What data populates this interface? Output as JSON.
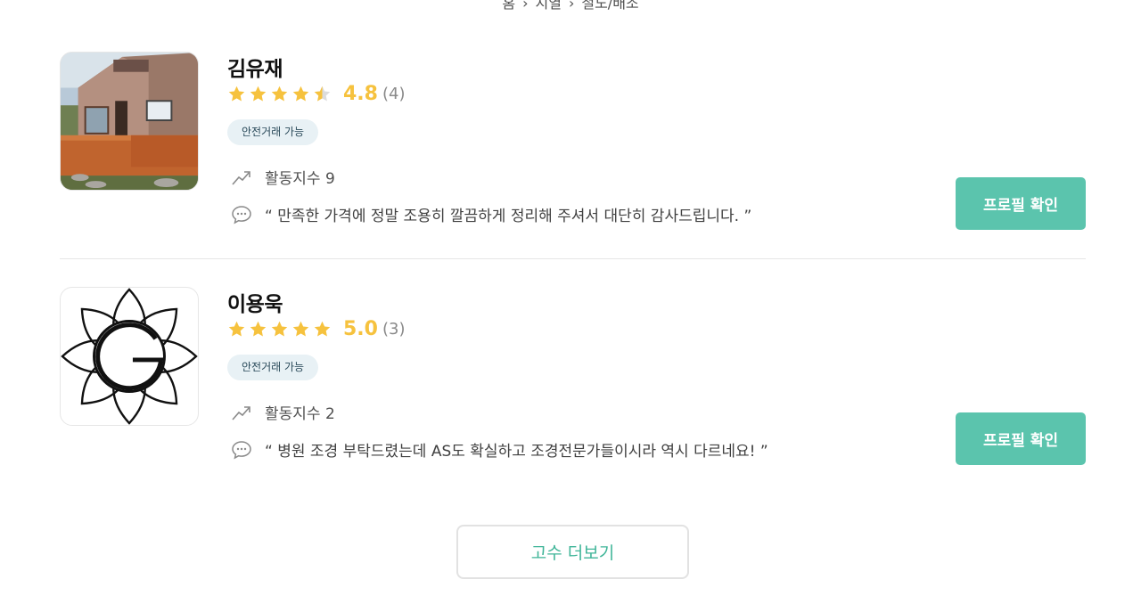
{
  "breadcrumb": [
    "홈",
    "지열",
    "철도/배조"
  ],
  "colors": {
    "accent": "#5bc4ad",
    "star": "#f6c23e",
    "badge_bg": "#e8f1f5",
    "more_text": "#3fb598"
  },
  "pros": [
    {
      "name": "김유재",
      "stars": 4.5,
      "score": "4.8",
      "count": "(4)",
      "badge": "안전거래 가능",
      "activity": "활동지수 9",
      "review": "“ 만족한 가격에 정말 조용히 깔끔하게 정리해 주셔서 대단히 감사드립니다. ”",
      "button": "프로필 확인",
      "image": "house-deck-photo"
    },
    {
      "name": "이용욱",
      "stars": 5,
      "score": "5.0",
      "count": "(3)",
      "badge": "안전거래 가능",
      "activity": "활동지수 2",
      "review": "“ 병원 조경 부탁드렸는데 AS도 확실하고 조경전문가들이시라 역시 다르네요! ”",
      "button": "프로필 확인",
      "image": "g-flower-logo"
    }
  ],
  "more_button": "고수 더보기",
  "icons": {
    "activity": "trend-up-icon",
    "review": "chat-bubble-icon",
    "star": "star-icon"
  }
}
